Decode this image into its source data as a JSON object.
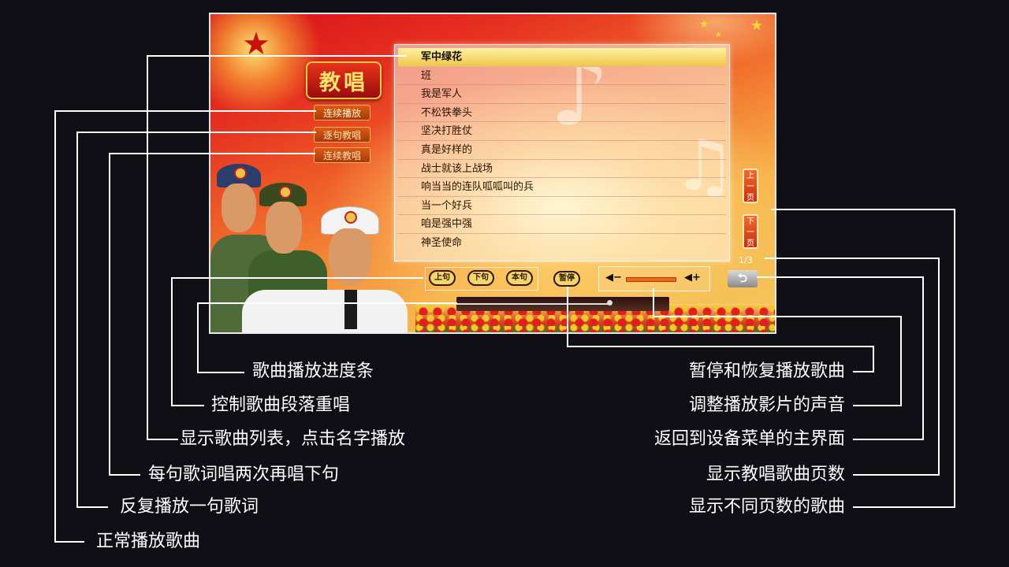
{
  "screen": {
    "logo_text": "教唱",
    "modes": [
      {
        "label": "连续播放"
      },
      {
        "label": "逐句教唱"
      },
      {
        "label": "连续教唱"
      }
    ],
    "songs": [
      {
        "title": "军中绿花",
        "selected": true
      },
      {
        "title": "班"
      },
      {
        "title": "我是军人"
      },
      {
        "title": "不松铁拳头"
      },
      {
        "title": "坚决打胜仗"
      },
      {
        "title": "真是好样的"
      },
      {
        "title": "战士就该上战场"
      },
      {
        "title": "响当当的连队呱呱叫的兵"
      },
      {
        "title": "当一个好兵"
      },
      {
        "title": "咱是强中强"
      },
      {
        "title": "神圣使命"
      }
    ],
    "page_up_label": "上一页",
    "page_down_label": "下一页",
    "page_indicator": "1/3",
    "controls": {
      "prev_line": "上句",
      "next_line": "下句",
      "this_line": "本句",
      "pause": "暂停",
      "volume_minus": "◀−",
      "volume_plus": "◀+",
      "volume_level": 0.7,
      "back_icon": "return-arrow-icon"
    },
    "progress": 0.72
  },
  "annotations": {
    "left": [
      {
        "text": "歌曲播放进度条"
      },
      {
        "text": "控制歌曲段落重唱"
      },
      {
        "text": "显示歌曲列表，点击名字播放"
      },
      {
        "text": "每句歌词唱两次再唱下句"
      },
      {
        "text": "反复播放一句歌词"
      },
      {
        "text": "正常播放歌曲"
      }
    ],
    "right": [
      {
        "text": "暂停和恢复播放歌曲"
      },
      {
        "text": "调整播放影片的声音"
      },
      {
        "text": "返回到设备菜单的主界面"
      },
      {
        "text": "显示教唱歌曲页数"
      },
      {
        "text": "显示不同页数的歌曲"
      }
    ]
  },
  "colors": {
    "background": "#0f0f15",
    "leader_line": "#ffffff",
    "logo_text": "#ffe36a",
    "selected_row": "#f0c64a"
  }
}
